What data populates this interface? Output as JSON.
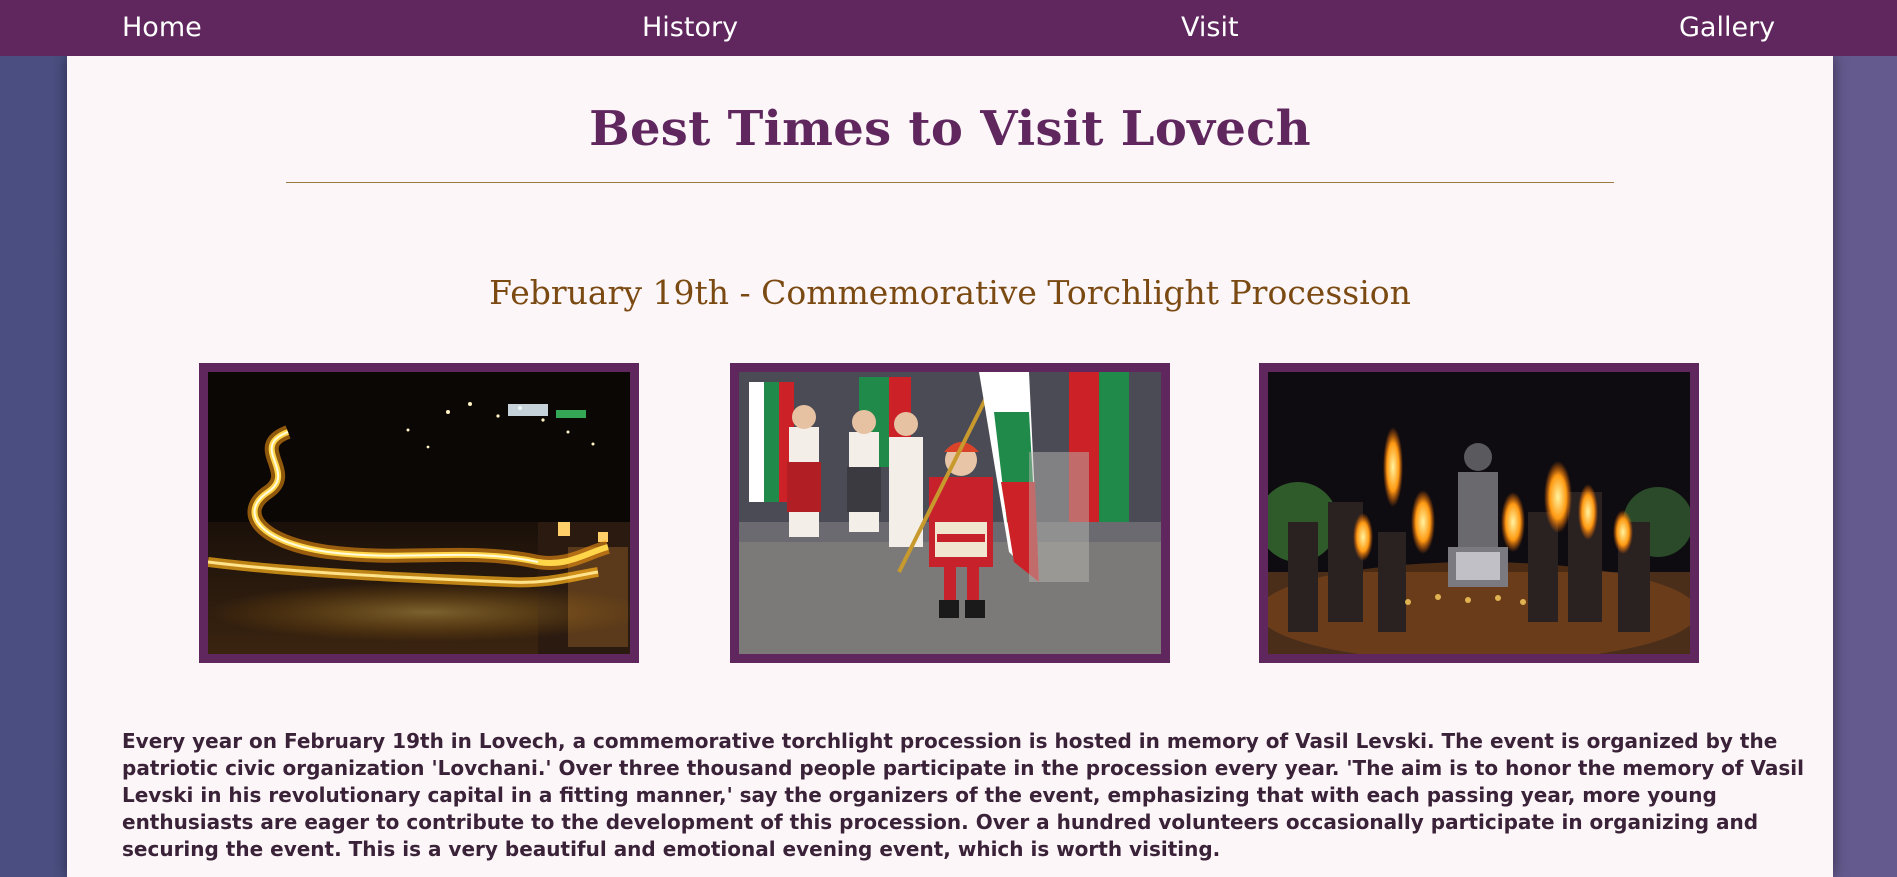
{
  "nav": {
    "items": [
      {
        "label": "Home"
      },
      {
        "label": "History"
      },
      {
        "label": "Visit"
      },
      {
        "label": "Gallery"
      }
    ]
  },
  "main": {
    "title": "Best Times to Visit Lovech",
    "section": {
      "heading": "February 19th - Commemorative Torchlight Procession",
      "photos": [
        {
          "subject": "night-torch-trail"
        },
        {
          "subject": "folk-costume-flag-parade"
        },
        {
          "subject": "torchbearers-at-monument"
        }
      ],
      "description": "Every year on February 19th in Lovech, a commemorative torchlight procession is hosted in memory of Vasil Levski. The event is organized by the patriotic civic organization 'Lovchani.' Over three thousand people participate in the procession every year. 'The aim is to honor the memory of Vasil Levski in his revolutionary capital in a fitting manner,' say the organizers of the event, emphasizing that with each passing year, more young enthusiasts are eager to contribute to the development of this procession. Over a hundred volunteers occasionally participate in organizing and securing the event. This is a very beautiful and emotional evening event, which is worth visiting."
    }
  },
  "colors": {
    "nav_bg": "#5f275e",
    "content_bg": "#fdf6f8",
    "title": "#5f275e",
    "section_heading": "#7a4a12",
    "rule": "#9a7a3e",
    "photo_border": "#5f275e",
    "body_text": "#3a2238"
  }
}
